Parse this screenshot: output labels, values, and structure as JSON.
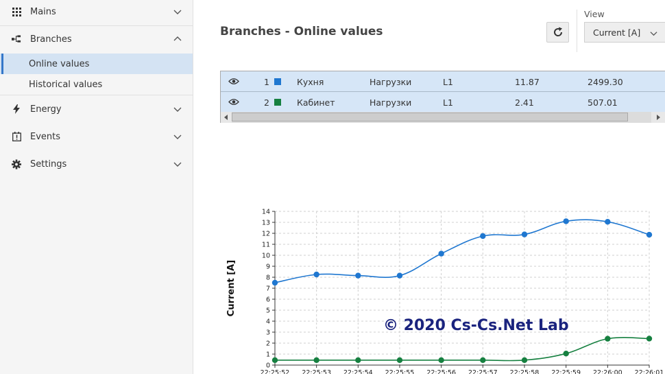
{
  "sidebar": {
    "mains": "Mains",
    "branches": "Branches",
    "online_values": "Online values",
    "historical_values": "Historical values",
    "energy": "Energy",
    "events": "Events",
    "settings": "Settings"
  },
  "header": {
    "title": "Branches - Online values",
    "view_label": "View",
    "view_selected": "Current [A]"
  },
  "table": {
    "rows": [
      {
        "num": "1",
        "name": "Кухня",
        "type": "Нагрузки",
        "phase": "L1",
        "current": "11.87",
        "power": "2499.30",
        "color": "#1f77d0"
      },
      {
        "num": "2",
        "name": "Кабинет",
        "type": "Нагрузки",
        "phase": "L1",
        "current": "2.41",
        "power": "507.01",
        "color": "#168040"
      }
    ]
  },
  "chart_data": {
    "type": "line",
    "ylabel": "Current [A]",
    "ylim": [
      0,
      14
    ],
    "yticks": [
      "0",
      "1",
      "2",
      "3",
      "4",
      "5",
      "6",
      "7",
      "8",
      "9",
      "10",
      "11",
      "12",
      "13",
      "14"
    ],
    "categories": [
      "22:25:52",
      "22:25:53",
      "22:25:54",
      "22:25:55",
      "22:25:56",
      "22:25:57",
      "22:25:58",
      "22:25:59",
      "22:26:00",
      "22:26:01"
    ],
    "series": [
      {
        "values": [
          7.5,
          8.25,
          8.15,
          8.15,
          10.15,
          11.75,
          11.9,
          13.1,
          13.05,
          11.87
        ],
        "color": "#1f77d0"
      },
      {
        "values": [
          0.45,
          0.45,
          0.45,
          0.45,
          0.45,
          0.45,
          0.45,
          1.05,
          2.4,
          2.41
        ],
        "color": "#168040"
      }
    ],
    "grid": true
  },
  "watermark": "© 2020 Cs-Cs.Net Lab"
}
